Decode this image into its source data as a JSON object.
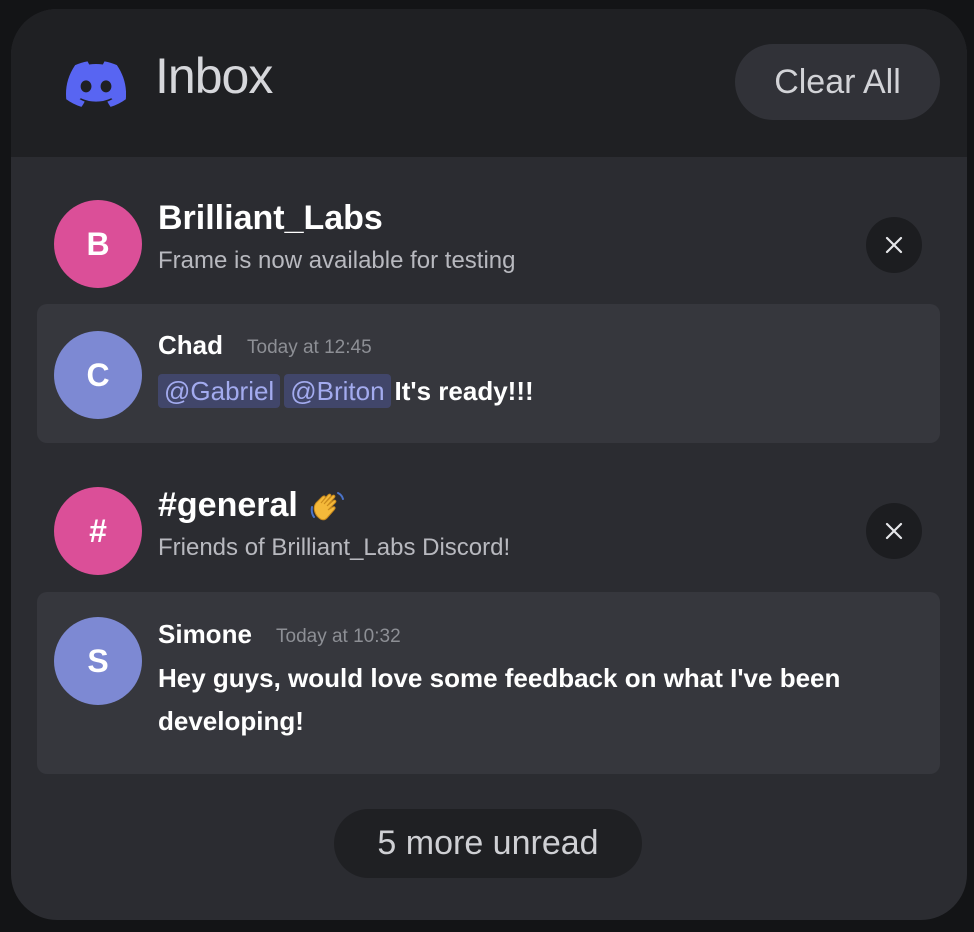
{
  "header": {
    "title": "Inbox",
    "clear_label": "Clear All",
    "logo_icon": "discord-logo-icon"
  },
  "colors": {
    "panel": "#2b2c31",
    "header": "#1f2023",
    "card": "#36373d",
    "avatar_pink": "#db4f98",
    "avatar_blue": "#7d89d3",
    "brand": "#5865f2",
    "mention_bg": "#41466a",
    "mention_text": "#a3abef"
  },
  "groups": [
    {
      "avatar_letter": "B",
      "name": "Brilliant_Labs",
      "description": "Frame is now available for testing",
      "close_icon": "close-icon",
      "message": {
        "avatar_letter": "C",
        "author": "Chad",
        "timestamp": "Today at 12:45",
        "mentions": [
          "@Gabriel",
          "@Briton"
        ],
        "text": "It's ready!!!"
      }
    },
    {
      "avatar_letter": "#",
      "name": "#general",
      "emoji_icon": "waving-hand-icon",
      "description": "Friends of Brilliant_Labs Discord!",
      "close_icon": "close-icon",
      "message": {
        "avatar_letter": "S",
        "author": "Simone",
        "timestamp": "Today at 10:32",
        "text": "Hey guys, would love some feedback on what I've been developing!"
      }
    }
  ],
  "footer": {
    "more_label": "5 more unread"
  }
}
